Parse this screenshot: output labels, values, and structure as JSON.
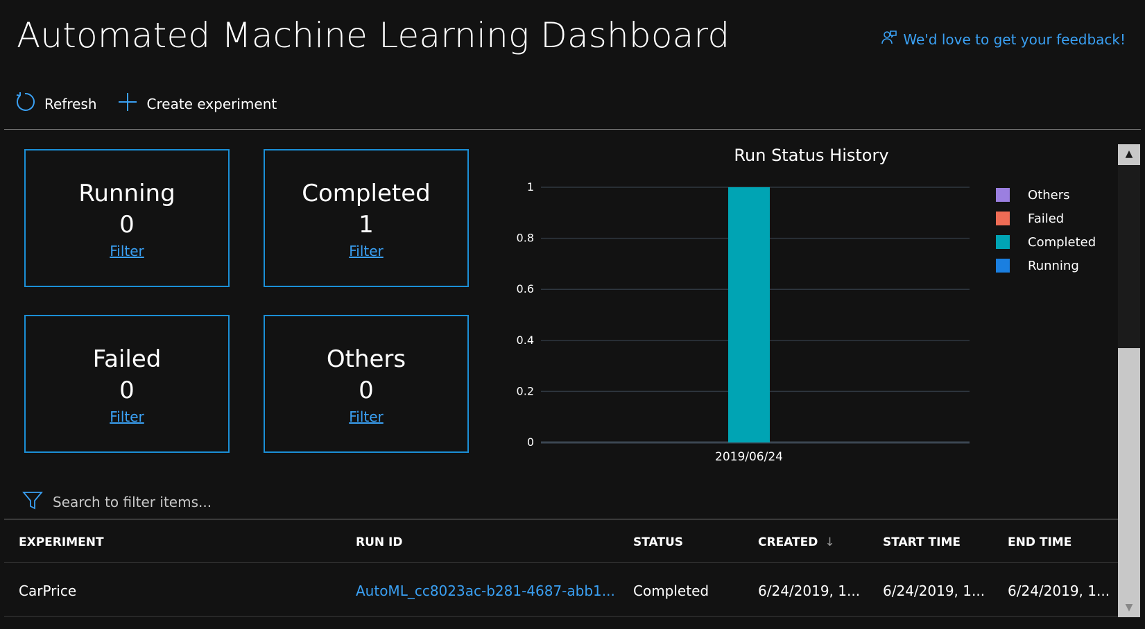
{
  "header": {
    "title": "Automated Machine Learning Dashboard",
    "feedback_label": "We'd love to get your feedback!"
  },
  "toolbar": {
    "refresh_label": "Refresh",
    "create_label": "Create experiment"
  },
  "tiles": [
    {
      "label": "Running",
      "count": "0",
      "filter": "Filter"
    },
    {
      "label": "Completed",
      "count": "1",
      "filter": "Filter"
    },
    {
      "label": "Failed",
      "count": "0",
      "filter": "Filter"
    },
    {
      "label": "Others",
      "count": "0",
      "filter": "Filter"
    }
  ],
  "chart_data": {
    "type": "bar",
    "title": "Run Status History",
    "categories": [
      "2019/06/24"
    ],
    "series": [
      {
        "name": "Others",
        "values": [
          0
        ],
        "color": "#9b7fe0"
      },
      {
        "name": "Failed",
        "values": [
          0
        ],
        "color": "#ef6c55"
      },
      {
        "name": "Completed",
        "values": [
          1
        ],
        "color": "#00a4b4"
      },
      {
        "name": "Running",
        "values": [
          0
        ],
        "color": "#1a7fe0"
      }
    ],
    "stacked": true,
    "ylim": [
      0,
      1
    ],
    "yticks": [
      "0",
      "0.2",
      "0.4",
      "0.6",
      "0.8",
      "1"
    ],
    "xlabel": "",
    "ylabel": "",
    "grid": true,
    "legend_position": "right"
  },
  "search": {
    "placeholder": "Search to filter items..."
  },
  "table": {
    "columns": [
      "EXPERIMENT",
      "RUN ID",
      "STATUS",
      "CREATED",
      "START TIME",
      "END TIME"
    ],
    "rows": [
      [
        "CarPrice",
        "AutoML_cc8023ac-b281-4687-abb1...",
        "Completed",
        "6/24/2019, 1...",
        "6/24/2019, 1...",
        "6/24/2019, 1..."
      ]
    ]
  },
  "colors": {
    "accent": "#3aa0f3",
    "tile_border": "#1b8fd6",
    "background": "#121212"
  },
  "icons": {
    "feedback": "feedback-person-icon",
    "refresh": "refresh-icon",
    "create": "plus-icon",
    "filter": "funnel-icon",
    "sort": "sort-down-arrow-icon"
  }
}
